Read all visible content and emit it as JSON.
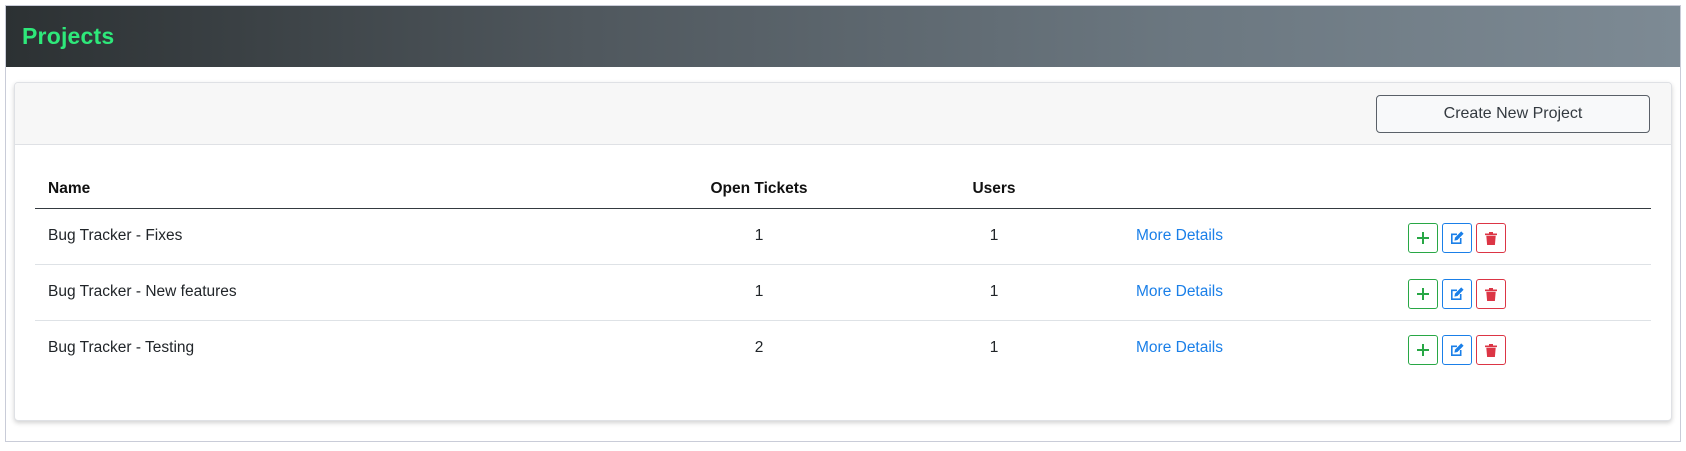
{
  "header": {
    "title": "Projects",
    "title_color": "#2ee87a"
  },
  "toolbar": {
    "create_label": "Create New Project"
  },
  "table": {
    "columns": [
      "Name",
      "Open Tickets",
      "Users"
    ],
    "rows": [
      {
        "name": "Bug Tracker - Fixes",
        "open_tickets": "1",
        "users": "1",
        "link": "More Details"
      },
      {
        "name": "Bug Tracker - New features",
        "open_tickets": "1",
        "users": "1",
        "link": "More Details"
      },
      {
        "name": "Bug Tracker - Testing",
        "open_tickets": "2",
        "users": "1",
        "link": "More Details"
      }
    ]
  },
  "icons": {
    "add": "plus-icon",
    "edit": "edit-icon",
    "delete": "trash-icon"
  },
  "colors": {
    "add": "#28a745",
    "edit": "#1a7fe8",
    "delete": "#dc3545",
    "link": "#1a7fe8"
  }
}
